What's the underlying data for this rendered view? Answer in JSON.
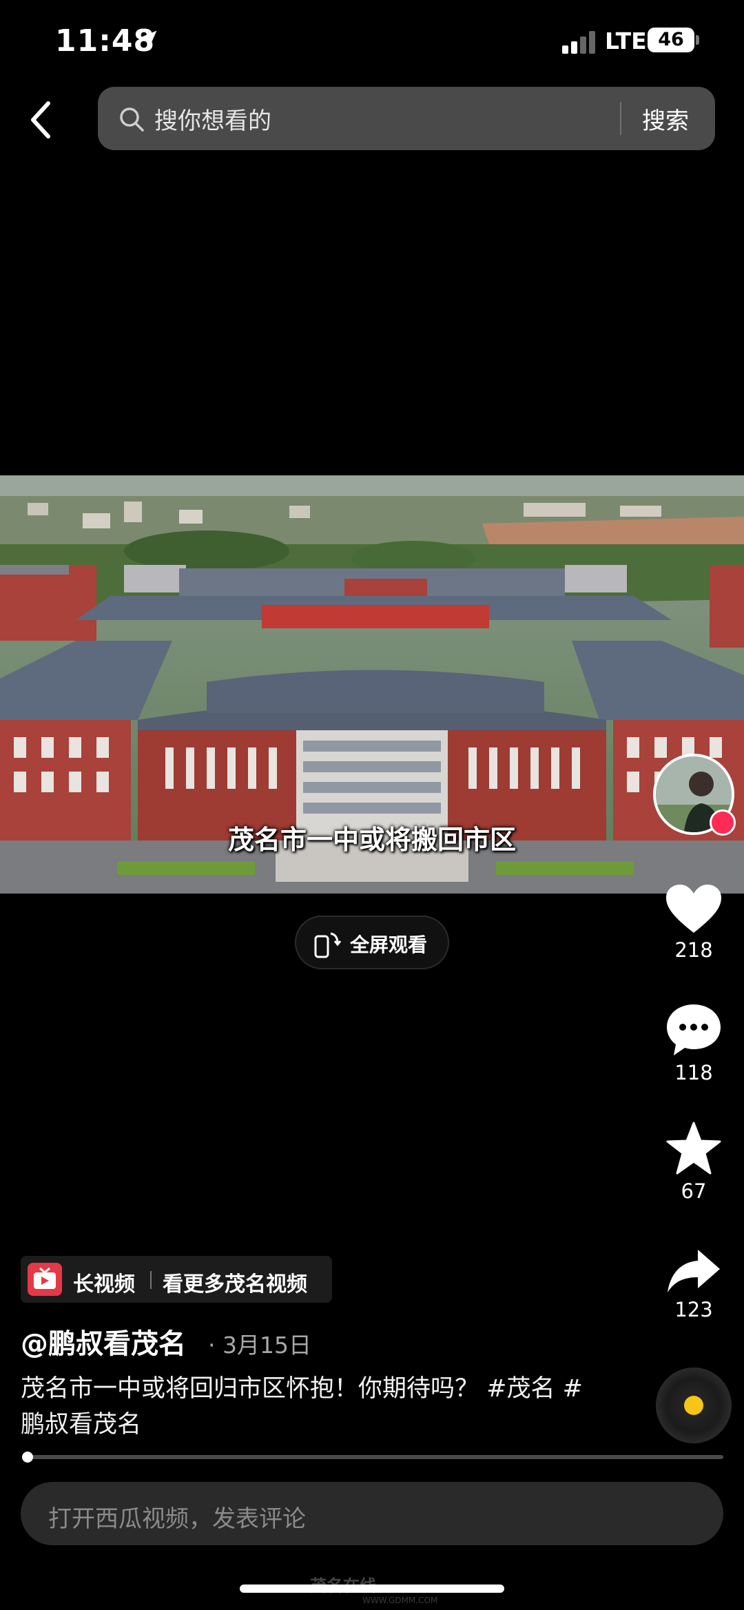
{
  "status_bar": {
    "time": "11:48",
    "network": "LTE",
    "battery": "46",
    "location_icon": "location-arrow-icon",
    "signal_icon": "signal-bars-icon"
  },
  "top_nav": {
    "back_icon": "chevron-left-icon",
    "search_icon": "search-icon",
    "search_placeholder": "搜你想看的",
    "search_button": "搜索"
  },
  "video": {
    "subtitle": "茂名市一中或将搬回市区",
    "fullscreen_label": "全屏观看",
    "fullscreen_icon": "rotate-phone-icon"
  },
  "actions": {
    "like_count": "218",
    "comment_count": "118",
    "favorite_count": "67",
    "share_count": "123",
    "like_icon": "heart-icon",
    "comment_icon": "comment-bubble-icon",
    "favorite_icon": "star-icon",
    "share_icon": "share-arrow-icon"
  },
  "post": {
    "long_video_label": "长视频",
    "more_label": "看更多茂名视频",
    "author": "@鹏叔看茂名",
    "date": "· 3月15日",
    "caption": "茂名市一中或将回归市区怀抱！你期待吗？ #茂名  #鹏叔看茂名",
    "progress": 0.01
  },
  "comment": {
    "placeholder": "打开西瓜视频，发表评论"
  },
  "watermark": {
    "text": "茂名在线",
    "sub": "WWW.GDMM.COM"
  },
  "colors": {
    "background": "#000000",
    "search_bg": "#4a4a4a",
    "badge_red": "#fe2c55",
    "long_video_red": "#e53948",
    "disc_center": "#f5c518"
  }
}
